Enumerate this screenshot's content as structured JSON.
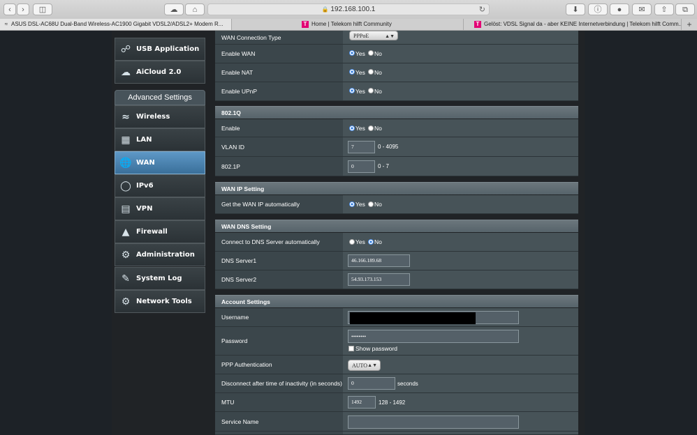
{
  "browser": {
    "url": "192.168.100.1",
    "tabs": [
      {
        "title": "ASUS DSL-AC68U Dual-Band Wireless-AC1900 Gigabit VDSL2/ADSL2+ Modem R...",
        "active": true
      },
      {
        "title": "Home | Telekom hilft Community",
        "active": false
      },
      {
        "title": "Gelöst: VDSL Signal da - aber KEINE Internetverbindung | Telekom hilft Comm...",
        "active": false
      }
    ],
    "new_tab": "+"
  },
  "sidebar": {
    "top_items": [
      {
        "label": "USB Application",
        "icon": "usb-icon"
      },
      {
        "label": "AiCloud 2.0",
        "icon": "cloud-icon"
      }
    ],
    "advanced_header": "Advanced Settings",
    "items": [
      {
        "label": "Wireless",
        "icon": "wireless-icon"
      },
      {
        "label": "LAN",
        "icon": "lan-icon"
      },
      {
        "label": "WAN",
        "icon": "globe-icon",
        "selected": true
      },
      {
        "label": "IPv6",
        "icon": "ipv6-icon"
      },
      {
        "label": "VPN",
        "icon": "vpn-icon"
      },
      {
        "label": "Firewall",
        "icon": "firewall-icon"
      },
      {
        "label": "Administration",
        "icon": "admin-gear-icon"
      },
      {
        "label": "System Log",
        "icon": "system-log-icon"
      },
      {
        "label": "Network Tools",
        "icon": "network-tools-icon"
      }
    ]
  },
  "radio": {
    "yes": "Yes",
    "no": "No"
  },
  "wan": {
    "connection_type": {
      "label": "WAN Connection Type",
      "value": "PPPoE"
    },
    "enable_wan": {
      "label": "Enable WAN",
      "value": "Yes"
    },
    "enable_nat": {
      "label": "Enable NAT",
      "value": "Yes"
    },
    "enable_upnp": {
      "label": "Enable UPnP",
      "value": "Yes"
    }
  },
  "dot1q": {
    "title": "802.1Q",
    "enable": {
      "label": "Enable",
      "value": "Yes"
    },
    "vlan_id": {
      "label": "VLAN ID",
      "value": "7",
      "hint": "0 - 4095"
    },
    "p8021p": {
      "label": "802.1P",
      "value": "0",
      "hint": "0 - 7"
    }
  },
  "wan_ip": {
    "title": "WAN IP Setting",
    "auto": {
      "label": "Get the WAN IP automatically",
      "value": "Yes"
    }
  },
  "wan_dns": {
    "title": "WAN DNS Setting",
    "auto": {
      "label": "Connect to DNS Server automatically",
      "value": "No"
    },
    "dns1": {
      "label": "DNS Server1",
      "value": "46.166.189.68"
    },
    "dns2": {
      "label": "DNS Server2",
      "value": "54.93.173.153"
    }
  },
  "account": {
    "title": "Account Settings",
    "username": {
      "label": "Username"
    },
    "password": {
      "label": "Password",
      "value": "••••••••",
      "show_label": "Show password"
    },
    "ppp_auth": {
      "label": "PPP Authentication",
      "value": "AUTO"
    },
    "idle": {
      "label": "Disconnect after time of inactivity (in seconds)",
      "value": "0",
      "unit": "seconds"
    },
    "mtu": {
      "label": "MTU",
      "value": "1492",
      "hint": "128 - 1492"
    },
    "service_name": {
      "label": "Service Name",
      "value": ""
    }
  }
}
